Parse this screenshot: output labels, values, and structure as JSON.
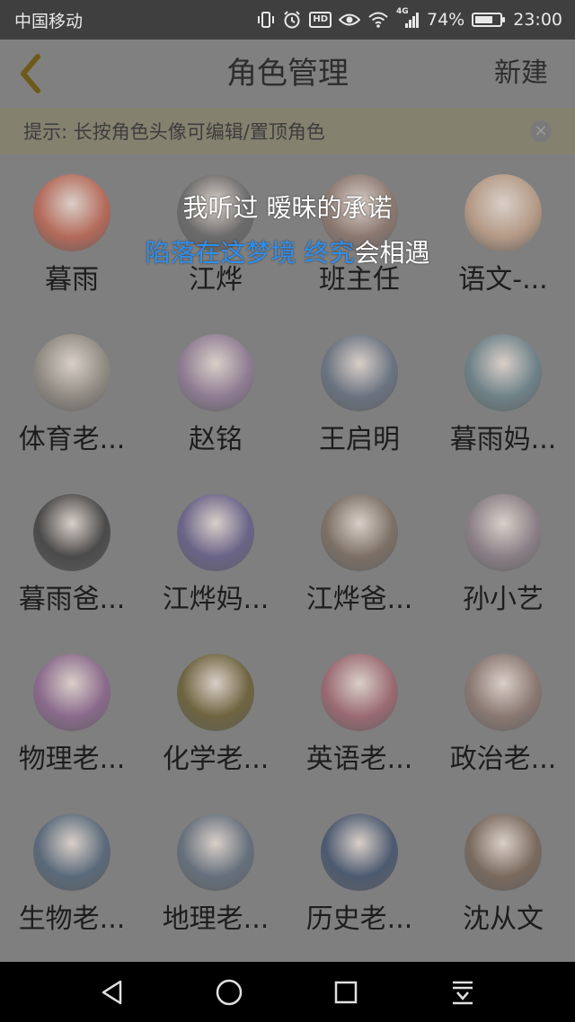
{
  "statusbar": {
    "carrier": "中国移动",
    "network": "4G",
    "battery_pct": "74%",
    "battery_level": 0.74,
    "time": "23:00",
    "icons": [
      "vibrate-icon",
      "alarm-icon",
      "hd-icon",
      "eye-icon",
      "wifi-icon",
      "signal-icon",
      "battery-icon"
    ]
  },
  "appbar": {
    "title": "角色管理",
    "new_label": "新建",
    "back_icon": "chevron-left-icon",
    "accent": "#6e5a18"
  },
  "hint": {
    "text": "提示: 长按角色头像可编辑/置顶角色",
    "close_icon": "close-icon"
  },
  "lyrics": {
    "line1": "我听过 暧昧的承诺",
    "line2_highlight": "陷落在这梦境 终究",
    "line2_rest": "会相遇",
    "highlight_color": "#2f8ff0"
  },
  "characters": [
    {
      "name": "暮雨",
      "avatar_color": "#b46a5a"
    },
    {
      "name": "江烨",
      "avatar_color": "#6b6b6b"
    },
    {
      "name": "班主任",
      "avatar_color": "#8a7870"
    },
    {
      "name": "语文-...",
      "avatar_color": "#b49a86"
    },
    {
      "name": "体育老...",
      "avatar_color": "#8f8a82"
    },
    {
      "name": "赵铭",
      "avatar_color": "#8e7c92"
    },
    {
      "name": "王启明",
      "avatar_color": "#6a7380"
    },
    {
      "name": "暮雨妈...",
      "avatar_color": "#6e8288"
    },
    {
      "name": "暮雨爸...",
      "avatar_color": "#4a4a4a"
    },
    {
      "name": "江烨妈...",
      "avatar_color": "#6a6488"
    },
    {
      "name": "江烨爸...",
      "avatar_color": "#7c7066"
    },
    {
      "name": "孙小艺",
      "avatar_color": "#8a7f86"
    },
    {
      "name": "物理老...",
      "avatar_color": "#8a6a8c"
    },
    {
      "name": "化学老...",
      "avatar_color": "#6e6440"
    },
    {
      "name": "英语老...",
      "avatar_color": "#9a6a72"
    },
    {
      "name": "政治老...",
      "avatar_color": "#8a7872"
    },
    {
      "name": "生物老...",
      "avatar_color": "#5a6a7a"
    },
    {
      "name": "地理老...",
      "avatar_color": "#66707c"
    },
    {
      "name": "历史老...",
      "avatar_color": "#4c5a70"
    },
    {
      "name": "沈从文",
      "avatar_color": "#7a6a5e"
    }
  ],
  "navbar": {
    "icons": [
      "back-triangle-icon",
      "home-circle-icon",
      "recents-square-icon",
      "notification-pull-icon"
    ]
  }
}
